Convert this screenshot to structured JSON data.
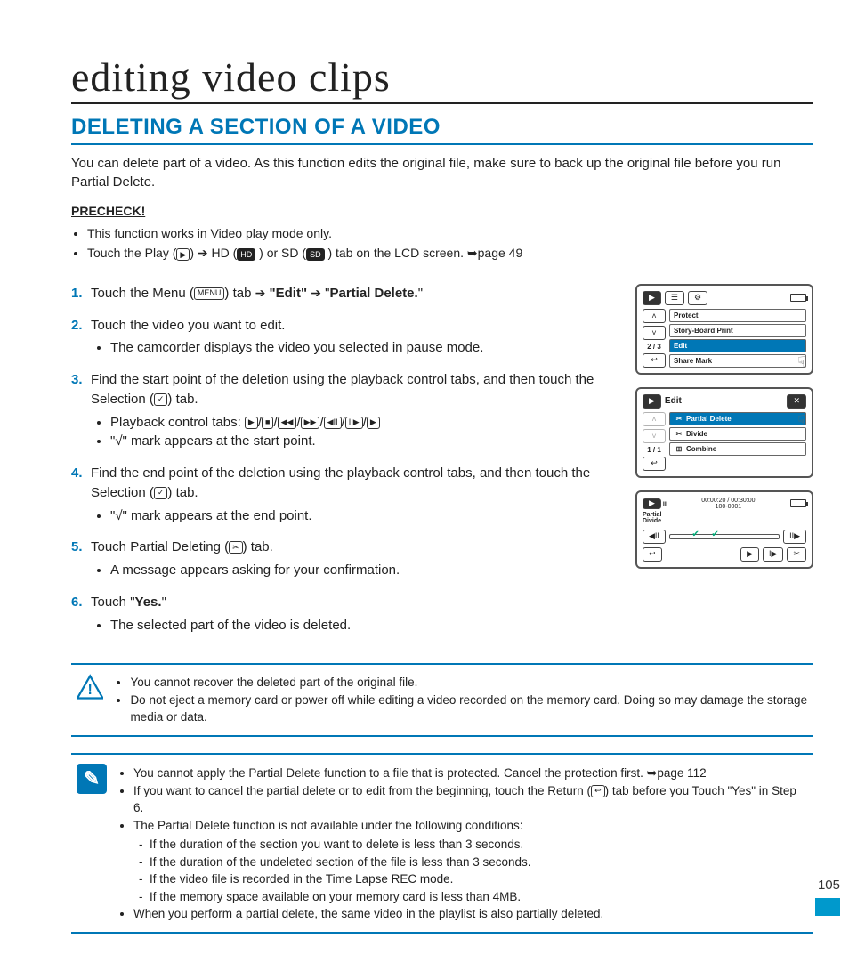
{
  "chapter_title": "editing video clips",
  "section_title": "DELETING A SECTION OF A VIDEO",
  "intro": "You can delete part of a video. As this function edits the original file, make sure to back up the original file before you run Partial Delete.",
  "precheck": {
    "title": "PRECHECK!",
    "items": {
      "a": "This function works in Video play mode only.",
      "b_pre": "Touch the Play (",
      "b_mid1": ") ",
      "b_hd": " HD (",
      "b_hd_post": " ) or SD (",
      "b_sd_post": " ) tab on the LCD screen. ",
      "b_ref": "page 49",
      "play_label": "▶",
      "hd_icon": "HD",
      "sd_icon": "SD"
    }
  },
  "steps": {
    "s1_pre": "Touch the Menu (",
    "s1_menu": "MENU",
    "s1_mid": ") tab ",
    "s1_edit": "\"Edit\"",
    "s1_pd": "\"Partial Delete.\"",
    "s2": "Touch the video you want to edit.",
    "s2b": "The camcorder displays the video you selected in pause mode.",
    "s3": "Find the start point of the deletion using the playback control tabs, and then touch the Selection (",
    "s3_post": ") tab.",
    "s3b_pre": "Playback control tabs: ",
    "s3c": "\"√\" mark appears at the start point.",
    "s4": "Find the end point of the deletion using the playback control tabs, and then touch the Selection (",
    "s4_post": ") tab.",
    "s4b": "\"√\" mark appears at the end point.",
    "s5_pre": "Touch Partial Deleting (",
    "s5_post": ") tab.",
    "s5b": "A message appears asking for your confirmation.",
    "s6_pre": "Touch \"",
    "s6_yes": "Yes.",
    "s6_post": "\"",
    "s6b": "The selected part of the video is deleted.",
    "pb": {
      "play": "▶",
      "stop": "■",
      "rew": "◀◀",
      "ff": "▶▶",
      "stepb": "◀II",
      "stepf": "II▶"
    },
    "sel_icon": "✓",
    "cut_icon": "✂"
  },
  "lcd1": {
    "counter": "2 / 3",
    "items": {
      "protect": "Protect",
      "sbp": "Story-Board Print",
      "edit": "Edit",
      "share": "Share Mark"
    }
  },
  "lcd2": {
    "title": "Edit",
    "counter": "1 / 1",
    "items": {
      "pd": "Partial Delete",
      "div": "Divide",
      "comb": "Combine"
    }
  },
  "lcd3": {
    "time": "00:00:20 / 00:30:00",
    "file": "100-0001",
    "label": "Partial\nDivide"
  },
  "callout1": {
    "a": "You cannot recover the deleted part of the original file.",
    "b": "Do not eject a memory card or power off while editing a video recorded on the memory card. Doing so may damage the storage media or data."
  },
  "callout2": {
    "a_pre": "You cannot apply the Partial Delete function to a file that is protected. Cancel the protection first. ",
    "a_ref": "page 112",
    "b_pre": "If you want to cancel the partial delete or to edit from the beginning, touch the Return (",
    "b_post": ") tab before you Touch \"Yes\" in Step 6.",
    "c": "The Partial Delete function is not available under the following conditions:",
    "c1": "If the duration of the section you want to delete is less than 3 seconds.",
    "c2": "If the duration of the undeleted section of the file is less than 3 seconds.",
    "c3": "If the video file is recorded in the Time Lapse REC mode.",
    "c4": "If the memory space available on your memory card is less than 4MB.",
    "d": "When you perform a partial delete, the same video in the playlist is also partially deleted.",
    "return_icon": "↩"
  },
  "page_number": "105"
}
